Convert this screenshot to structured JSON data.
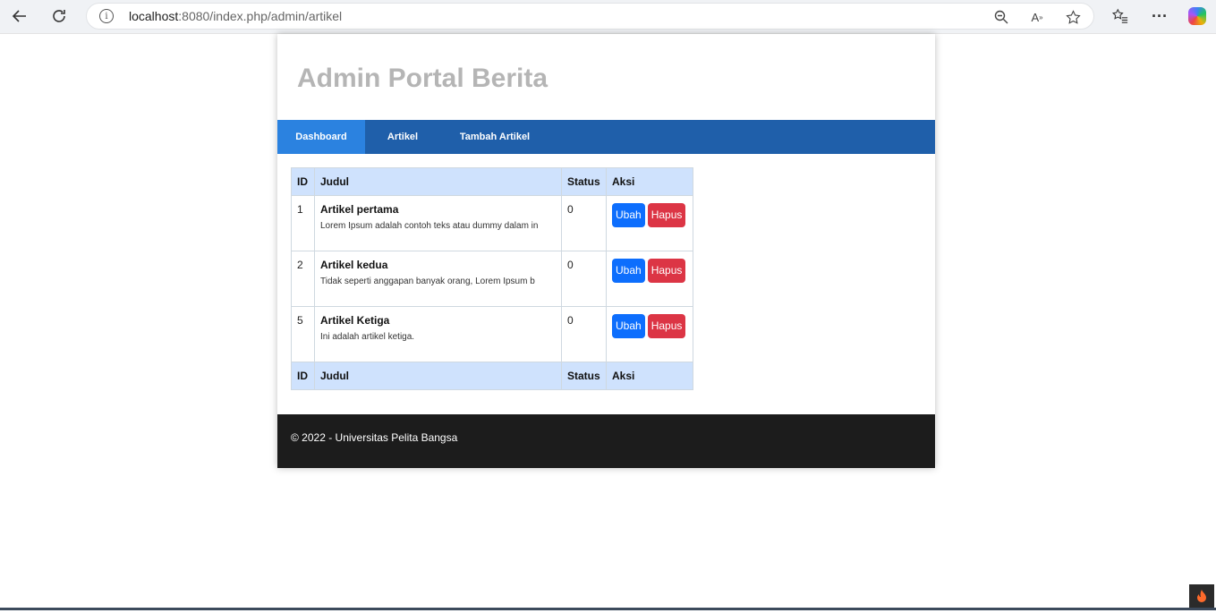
{
  "browser": {
    "url_host": "localhost",
    "url_path": ":8080/index.php/admin/artikel",
    "info_icon": "i"
  },
  "site": {
    "title": "Admin Portal Berita"
  },
  "nav": {
    "items": [
      {
        "label": "Dashboard",
        "active": true
      },
      {
        "label": "Artikel",
        "active": false
      },
      {
        "label": "Tambah Artikel",
        "active": false
      }
    ]
  },
  "table": {
    "headers": [
      "ID",
      "Judul",
      "Status",
      "Aksi"
    ],
    "rows": [
      {
        "id": "1",
        "judul": "Artikel pertama",
        "isi": "Lorem Ipsum adalah contoh teks atau dummy dalam in",
        "status": "0",
        "ubah": "Ubah",
        "hapus": "Hapus"
      },
      {
        "id": "2",
        "judul": "Artikel kedua",
        "isi": "Tidak seperti anggapan banyak orang, Lorem Ipsum b",
        "status": "0",
        "ubah": "Ubah",
        "hapus": "Hapus"
      },
      {
        "id": "5",
        "judul": "Artikel Ketiga",
        "isi": "Ini adalah artikel ketiga.",
        "status": "0",
        "ubah": "Ubah",
        "hapus": "Hapus"
      }
    ],
    "footers": [
      "ID",
      "Judul",
      "Status",
      "Aksi"
    ]
  },
  "footer": {
    "text": "© 2022 - Universitas Pelita Bangsa"
  },
  "colors": {
    "navbar": "#1f5faa",
    "nav_active": "#2b82e0",
    "table_head": "#cfe2fd",
    "btn_ubah": "#0d6efd",
    "btn_hapus": "#dc3545",
    "footer": "#1c1c1c"
  },
  "icons": [
    "back-icon",
    "refresh-icon",
    "info-icon",
    "zoom-out-icon",
    "read-aloud-icon",
    "favorite-star-icon",
    "favorites-list-icon",
    "more-icon",
    "copilot-icon",
    "flame-icon"
  ]
}
